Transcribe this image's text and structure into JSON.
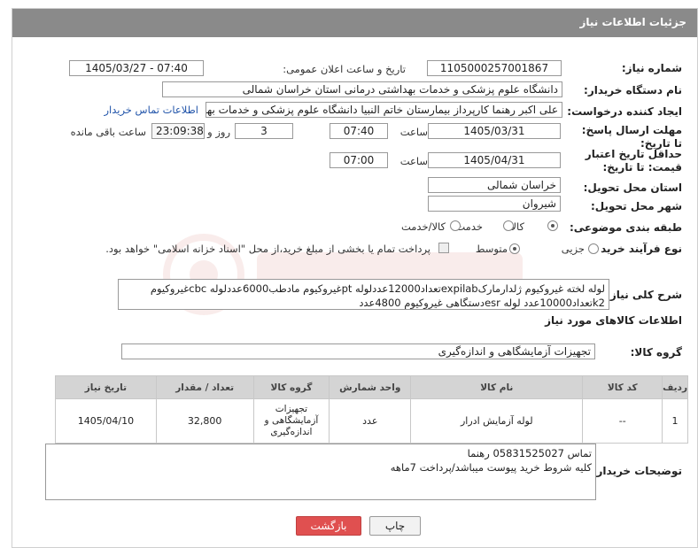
{
  "panel_title": "جزئیات اطلاعات نیاز",
  "fields": {
    "need_number_label": "شماره نیاز:",
    "need_number": "1105000257001867",
    "announce_label": "تاریخ و ساعت اعلان عمومی:",
    "announce_value": "1405/03/27 - 07:40",
    "buyer_org_label": "نام دستگاه خریدار:",
    "buyer_org": "دانشگاه علوم پزشکی و خدمات بهداشتی درمانی استان خراسان شمالی",
    "creator_label": "ایجاد کننده درخواست:",
    "creator": "علی اکبر رهنما کارپرداز بیمارستان خاتم النبیا دانشگاه علوم پزشکی و خدمات بهداشتی",
    "buyer_contact_link": "اطلاعات تماس خریدار",
    "deadline_label": "مهلت ارسال پاسخ: تا تاریخ:",
    "deadline_date": "1405/03/31",
    "time_label": "ساعت",
    "deadline_time": "07:40",
    "days_value": "3",
    "days_label": "روز و",
    "remaining_time": "23:09:38",
    "remaining_label": "ساعت باقی مانده",
    "min_price_label": "حداقل تاریخ اعتبار قیمت: تا تاریخ:",
    "min_price_date": "1405/04/31",
    "min_price_time": "07:00",
    "province_label": "استان محل تحویل:",
    "province": "خراسان شمالی",
    "city_label": "شهر محل تحویل:",
    "city": "شیروان",
    "category_label": "طبقه بندی موضوعی:",
    "category_options": [
      "کالا",
      "خدمت",
      "کالا/خدمت"
    ],
    "process_label": "نوع فرآیند خرید :",
    "process_options": [
      "جزیی",
      "متوسط"
    ],
    "process_note": "پرداخت تمام یا بخشی از مبلغ خرید،از محل \"اسناد خزانه اسلامی\" خواهد بود."
  },
  "overall_desc_label": "شرح کلی نیاز:",
  "overall_desc": "لوله لخته غیروکیوم ژلدارمارکexpilabتعداد12000عددلوله ptغیروکیوم مادطب6000عددلوله cbcغیروکیوم k2تعداد10000عدد لوله esrدستگاهی غیروکیوم 4800عدد",
  "items_section_title": "اطلاعات کالاهای مورد نیاز",
  "goods_group_label": "گروه کالا:",
  "goods_group": "تجهیزات آزمایشگاهی و اندازه‌گیری",
  "table": {
    "headers": [
      "ردیف",
      "کد کالا",
      "نام کالا",
      "واحد شمارش",
      "گروه کالا",
      "تعداد / مقدار",
      "تاریخ نیاز"
    ],
    "rows": [
      [
        "1",
        "--",
        "لوله آزمایش ادرار",
        "عدد",
        "تجهیزات آزمایشگاهی و اندازه‌گیری",
        "32,800",
        "1405/04/10"
      ]
    ]
  },
  "buyer_notes_label": "توضیحات خریدار:",
  "buyer_notes_line1": "تماس 05831525027 رهنما",
  "buyer_notes_line2": "کلیه شروط خرید پیوست میباشد/پرداخت 7ماهه",
  "buttons": {
    "print": "چاپ",
    "back": "بازگشت"
  }
}
